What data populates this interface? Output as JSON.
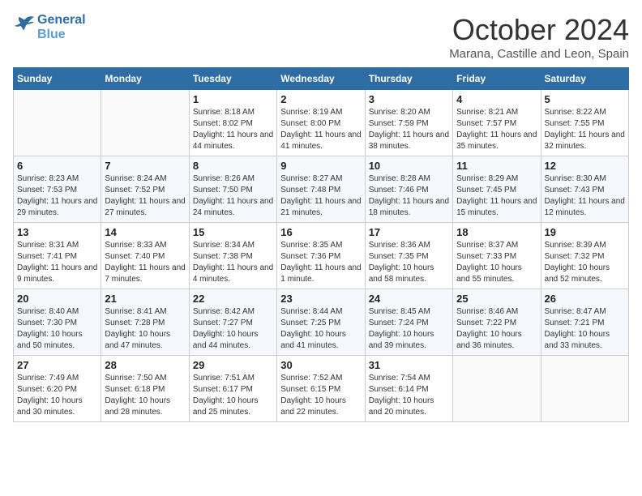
{
  "header": {
    "logo_line1": "General",
    "logo_line2": "Blue",
    "month": "October 2024",
    "location": "Marana, Castille and Leon, Spain"
  },
  "weekdays": [
    "Sunday",
    "Monday",
    "Tuesday",
    "Wednesday",
    "Thursday",
    "Friday",
    "Saturday"
  ],
  "weeks": [
    [
      {
        "day": "",
        "info": ""
      },
      {
        "day": "",
        "info": ""
      },
      {
        "day": "1",
        "info": "Sunrise: 8:18 AM\nSunset: 8:02 PM\nDaylight: 11 hours and 44 minutes."
      },
      {
        "day": "2",
        "info": "Sunrise: 8:19 AM\nSunset: 8:00 PM\nDaylight: 11 hours and 41 minutes."
      },
      {
        "day": "3",
        "info": "Sunrise: 8:20 AM\nSunset: 7:59 PM\nDaylight: 11 hours and 38 minutes."
      },
      {
        "day": "4",
        "info": "Sunrise: 8:21 AM\nSunset: 7:57 PM\nDaylight: 11 hours and 35 minutes."
      },
      {
        "day": "5",
        "info": "Sunrise: 8:22 AM\nSunset: 7:55 PM\nDaylight: 11 hours and 32 minutes."
      }
    ],
    [
      {
        "day": "6",
        "info": "Sunrise: 8:23 AM\nSunset: 7:53 PM\nDaylight: 11 hours and 29 minutes."
      },
      {
        "day": "7",
        "info": "Sunrise: 8:24 AM\nSunset: 7:52 PM\nDaylight: 11 hours and 27 minutes."
      },
      {
        "day": "8",
        "info": "Sunrise: 8:26 AM\nSunset: 7:50 PM\nDaylight: 11 hours and 24 minutes."
      },
      {
        "day": "9",
        "info": "Sunrise: 8:27 AM\nSunset: 7:48 PM\nDaylight: 11 hours and 21 minutes."
      },
      {
        "day": "10",
        "info": "Sunrise: 8:28 AM\nSunset: 7:46 PM\nDaylight: 11 hours and 18 minutes."
      },
      {
        "day": "11",
        "info": "Sunrise: 8:29 AM\nSunset: 7:45 PM\nDaylight: 11 hours and 15 minutes."
      },
      {
        "day": "12",
        "info": "Sunrise: 8:30 AM\nSunset: 7:43 PM\nDaylight: 11 hours and 12 minutes."
      }
    ],
    [
      {
        "day": "13",
        "info": "Sunrise: 8:31 AM\nSunset: 7:41 PM\nDaylight: 11 hours and 9 minutes."
      },
      {
        "day": "14",
        "info": "Sunrise: 8:33 AM\nSunset: 7:40 PM\nDaylight: 11 hours and 7 minutes."
      },
      {
        "day": "15",
        "info": "Sunrise: 8:34 AM\nSunset: 7:38 PM\nDaylight: 11 hours and 4 minutes."
      },
      {
        "day": "16",
        "info": "Sunrise: 8:35 AM\nSunset: 7:36 PM\nDaylight: 11 hours and 1 minute."
      },
      {
        "day": "17",
        "info": "Sunrise: 8:36 AM\nSunset: 7:35 PM\nDaylight: 10 hours and 58 minutes."
      },
      {
        "day": "18",
        "info": "Sunrise: 8:37 AM\nSunset: 7:33 PM\nDaylight: 10 hours and 55 minutes."
      },
      {
        "day": "19",
        "info": "Sunrise: 8:39 AM\nSunset: 7:32 PM\nDaylight: 10 hours and 52 minutes."
      }
    ],
    [
      {
        "day": "20",
        "info": "Sunrise: 8:40 AM\nSunset: 7:30 PM\nDaylight: 10 hours and 50 minutes."
      },
      {
        "day": "21",
        "info": "Sunrise: 8:41 AM\nSunset: 7:28 PM\nDaylight: 10 hours and 47 minutes."
      },
      {
        "day": "22",
        "info": "Sunrise: 8:42 AM\nSunset: 7:27 PM\nDaylight: 10 hours and 44 minutes."
      },
      {
        "day": "23",
        "info": "Sunrise: 8:44 AM\nSunset: 7:25 PM\nDaylight: 10 hours and 41 minutes."
      },
      {
        "day": "24",
        "info": "Sunrise: 8:45 AM\nSunset: 7:24 PM\nDaylight: 10 hours and 39 minutes."
      },
      {
        "day": "25",
        "info": "Sunrise: 8:46 AM\nSunset: 7:22 PM\nDaylight: 10 hours and 36 minutes."
      },
      {
        "day": "26",
        "info": "Sunrise: 8:47 AM\nSunset: 7:21 PM\nDaylight: 10 hours and 33 minutes."
      }
    ],
    [
      {
        "day": "27",
        "info": "Sunrise: 7:49 AM\nSunset: 6:20 PM\nDaylight: 10 hours and 30 minutes."
      },
      {
        "day": "28",
        "info": "Sunrise: 7:50 AM\nSunset: 6:18 PM\nDaylight: 10 hours and 28 minutes."
      },
      {
        "day": "29",
        "info": "Sunrise: 7:51 AM\nSunset: 6:17 PM\nDaylight: 10 hours and 25 minutes."
      },
      {
        "day": "30",
        "info": "Sunrise: 7:52 AM\nSunset: 6:15 PM\nDaylight: 10 hours and 22 minutes."
      },
      {
        "day": "31",
        "info": "Sunrise: 7:54 AM\nSunset: 6:14 PM\nDaylight: 10 hours and 20 minutes."
      },
      {
        "day": "",
        "info": ""
      },
      {
        "day": "",
        "info": ""
      }
    ]
  ]
}
